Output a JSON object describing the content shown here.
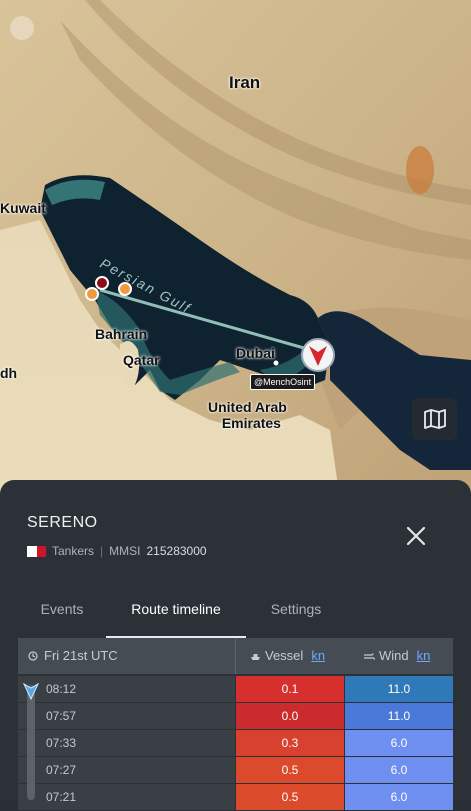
{
  "map": {
    "places": {
      "iran": "Iran",
      "kuwait": "Kuwait",
      "bahrain": "Bahrain",
      "qatar": "Qatar",
      "dubai": "Dubai",
      "uae_line1": "United Arab",
      "uae_line2": "Emirates",
      "persian_gulf": "Persian Gulf",
      "edge_left": "dh"
    },
    "watermark": "@MenchOsint",
    "layers_button_icon": "map-icon"
  },
  "vessel": {
    "name": "SERENO",
    "flag_colors": [
      "#ffffff",
      "#cf142b"
    ],
    "type": "Tankers",
    "mmsi_label": "MMSI",
    "mmsi": "215283000"
  },
  "tabs": [
    {
      "label": "Events",
      "active": false
    },
    {
      "label": "Route timeline",
      "active": true
    },
    {
      "label": "Settings",
      "active": false
    }
  ],
  "table": {
    "date_header": "Fri 21st UTC",
    "vessel_header": "Vessel",
    "vessel_unit": "kn",
    "wind_header": "Wind",
    "wind_unit": "kn",
    "rows": [
      {
        "time": "08:12",
        "vessel": "0.1",
        "wind": "11.0",
        "vessel_color": "#d6302e",
        "wind_color": "#2f79b8"
      },
      {
        "time": "07:57",
        "vessel": "0.0",
        "wind": "11.0",
        "vessel_color": "#cc2b2e",
        "wind_color": "#4b79d9"
      },
      {
        "time": "07:33",
        "vessel": "0.3",
        "wind": "6.0",
        "vessel_color": "#d8412d",
        "wind_color": "#6f8ff0"
      },
      {
        "time": "07:27",
        "vessel": "0.5",
        "wind": "6.0",
        "vessel_color": "#dc4a2c",
        "wind_color": "#6f8ff0"
      },
      {
        "time": "07:21",
        "vessel": "0.5",
        "wind": "6.0",
        "vessel_color": "#dc4a2c",
        "wind_color": "#6f8ff0"
      }
    ]
  }
}
